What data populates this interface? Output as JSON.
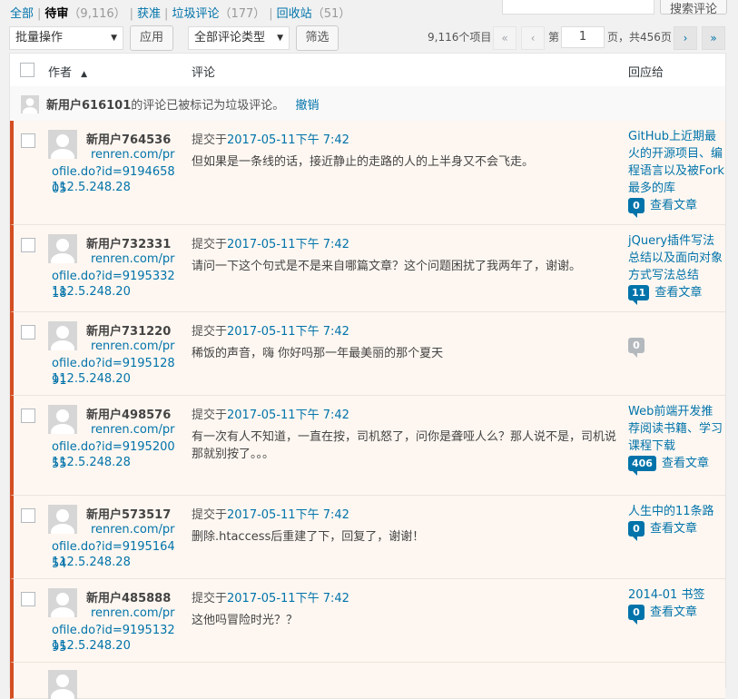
{
  "filters": [
    {
      "label": "全部",
      "count": "",
      "current": false
    },
    {
      "label": "待审",
      "count": "（9,116）",
      "current": true
    },
    {
      "label": "获准",
      "count": "",
      "current": false
    },
    {
      "label": "垃圾评论",
      "count": "（177）",
      "current": false
    },
    {
      "label": "回收站",
      "count": "（51）",
      "current": false
    }
  ],
  "search": {
    "button_label": "搜索评论",
    "value": ""
  },
  "tablenav": {
    "bulk_action": "批量操作",
    "apply_label": "应用",
    "type_filter": "全部评论类型",
    "filter_label": "筛选",
    "items_count": "9,116个项目",
    "first_page": "«",
    "prev_page": "‹",
    "page_prefix": "第",
    "current_page": "1",
    "page_suffix": "页，共456页",
    "next_page": "›",
    "last_page": "»"
  },
  "columns": {
    "author": "作者",
    "sort_indicator": "▲",
    "comment": "评论",
    "response": "回应给"
  },
  "notice": {
    "user": "新用户616101",
    "message": "的评论已被标记为垃圾评论。",
    "undo": "撤销"
  },
  "comments": [
    {
      "author": "新用户764536",
      "url": [
        "renren.com/pr",
        "ofile.do?id=919465805"
      ],
      "ip": "112.5.248.28",
      "submitted_prefix": "提交于",
      "date": "2017-05-11下午 7:42",
      "text": "但如果是一条线的话，接近静止的走路的人的上半身又不会飞走。",
      "response_title": "GitHub上近期最火的开源项目、编程语言以及被Fork 最多的库",
      "response_count": "0",
      "view_post": "查看文章"
    },
    {
      "author": "新用户732331",
      "url": [
        "renren.com/pr",
        "ofile.do?id=919533218"
      ],
      "ip": "112.5.248.20",
      "submitted_prefix": "提交于",
      "date": "2017-05-11下午 7:42",
      "text": "请问一下这个句式是不是来自哪篇文章？这个问题困扰了我两年了，谢谢。",
      "response_title": "jQuery插件写法总结以及面向对象方式写法总结",
      "response_count": "11",
      "view_post": "查看文章"
    },
    {
      "author": "新用户731220",
      "url": [
        "renren.com/pr",
        "ofile.do?id=919512891"
      ],
      "ip": "112.5.248.20",
      "submitted_prefix": "提交于",
      "date": "2017-05-11下午 7:42",
      "text": "稀饭的声音，嗨 你好吗那一年最美丽的那个夏天",
      "response_title": "",
      "response_count": "0",
      "view_post": ""
    },
    {
      "author": "新用户498576",
      "url": [
        "renren.com/pr",
        "ofile.do?id=919520055"
      ],
      "ip": "112.5.248.28",
      "submitted_prefix": "提交于",
      "date": "2017-05-11下午 7:42",
      "text": "有一次有人不知道，一直在按，司机怒了，问你是聋哑人么？那人说不是，司机说那就别按了。。。",
      "response_title": "Web前端开发推荐阅读书籍、学习课程下载",
      "response_count": "406",
      "view_post": "查看文章"
    },
    {
      "author": "新用户573517",
      "url": [
        "renren.com/pr",
        "ofile.do?id=919516454"
      ],
      "ip": "112.5.248.28",
      "submitted_prefix": "提交于",
      "date": "2017-05-11下午 7:42",
      "text": "删除.htaccess后重建了下，回复了，谢谢！",
      "response_title": "人生中的11条路",
      "response_count": "0",
      "view_post": "查看文章"
    },
    {
      "author": "新用户485888",
      "url": [
        "renren.com/pr",
        "ofile.do?id=919513295"
      ],
      "ip": "112.5.248.20",
      "submitted_prefix": "提交于",
      "date": "2017-05-11下午 7:42",
      "text": "这他吗冒险时光？？",
      "response_title": "2014-01 书签",
      "response_count": "0",
      "view_post": "查看文章"
    }
  ]
}
